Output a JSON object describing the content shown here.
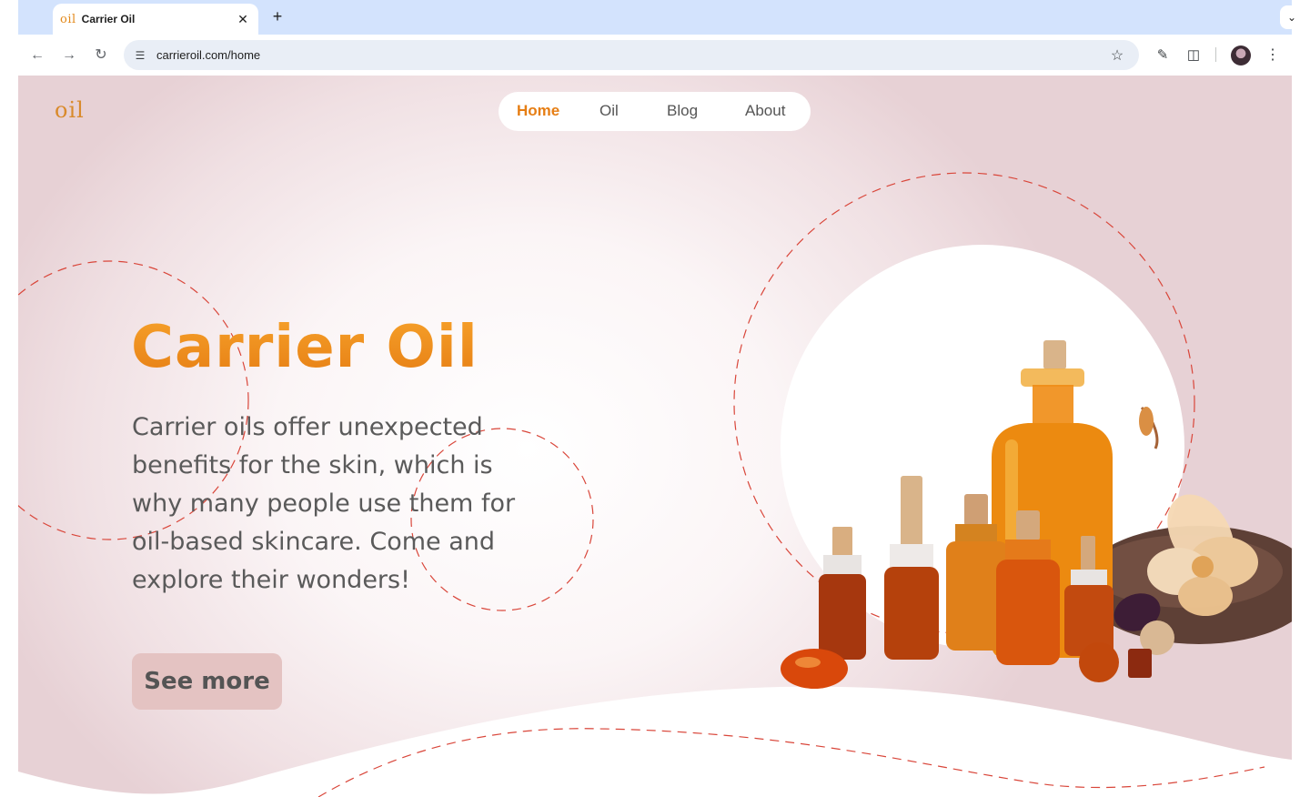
{
  "browser": {
    "tab_logo": "oil",
    "tab_title": "Carrier Oil",
    "tab_close": "✕",
    "new_tab": "+",
    "tab_menu": "⌄",
    "url": "carrieroil.com/home",
    "icons": [
      "back-arrow-icon",
      "forward-arrow-icon",
      "reload-icon",
      "site-info-icon",
      "bookmark-star-icon",
      "paint-brush-extension-icon",
      "extensions-puzzle-icon",
      "profile-avatar",
      "menu-kebab-icon"
    ]
  },
  "header": {
    "logo": "oil",
    "nav": [
      {
        "label": "Home",
        "active": true
      },
      {
        "label": "Oil",
        "active": false
      },
      {
        "label": "Blog",
        "active": false
      },
      {
        "label": "About",
        "active": false
      }
    ]
  },
  "hero": {
    "title": "Carrier Oil",
    "text": "Carrier oils offer unexpected benefits for the skin, which is why many people use them for oil-based skincare. Come and explore their wonders!",
    "cta": "See more"
  },
  "colors": {
    "accent": "#e67e14",
    "button_bg": "#e4c3c2",
    "dash": "#d9463a",
    "chrome_tab_strip": "#d3e3fd"
  }
}
